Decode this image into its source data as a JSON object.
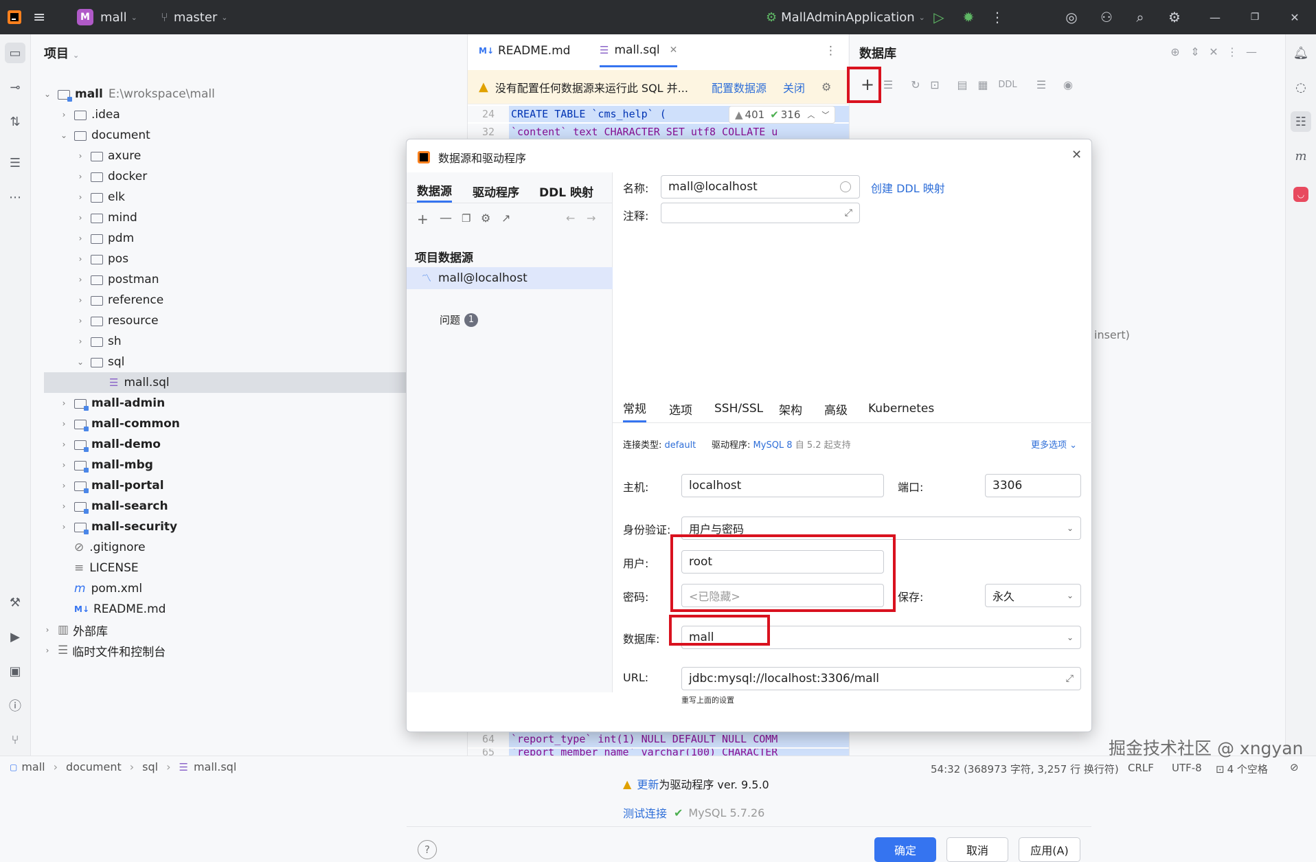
{
  "titlebar": {
    "project_badge": "M",
    "project_name": "mall",
    "branch": "master",
    "run_config": "MallAdminApplication"
  },
  "project_panel": {
    "title": "项目",
    "tree": [
      {
        "label": "mall",
        "extra": "E:\\wrokspace\\mall"
      },
      {
        "label": ".idea"
      },
      {
        "label": "document"
      },
      {
        "label": "axure"
      },
      {
        "label": "docker"
      },
      {
        "label": "elk"
      },
      {
        "label": "mind"
      },
      {
        "label": "pdm"
      },
      {
        "label": "pos"
      },
      {
        "label": "postman"
      },
      {
        "label": "reference"
      },
      {
        "label": "resource"
      },
      {
        "label": "sh"
      },
      {
        "label": "sql"
      },
      {
        "label": "mall.sql"
      },
      {
        "label": "mall-admin"
      },
      {
        "label": "mall-common"
      },
      {
        "label": "mall-demo"
      },
      {
        "label": "mall-mbg"
      },
      {
        "label": "mall-portal"
      },
      {
        "label": "mall-search"
      },
      {
        "label": "mall-security"
      },
      {
        "label": ".gitignore"
      },
      {
        "label": "LICENSE"
      },
      {
        "label": "pom.xml"
      },
      {
        "label": "README.md"
      },
      {
        "label": "外部库"
      },
      {
        "label": "临时文件和控制台"
      }
    ]
  },
  "editor": {
    "tabs": [
      {
        "icon": "M↓",
        "label": "README.md"
      },
      {
        "label": "mall.sql"
      }
    ],
    "warning": "没有配置任何数据源来运行此 SQL 并...",
    "configure_link": "配置数据源",
    "close_link": "关闭",
    "lines": [
      {
        "n": "24",
        "code": "CREATE TABLE `cms_help`  ("
      },
      {
        "n": "32",
        "code": "  `content` text CHARACTER SET utf8 COLLATE u"
      },
      {
        "n": "64",
        "code": "  `report_type` int(1) NULL DEFAULT NULL COMM"
      },
      {
        "n": "65",
        "code": "  `report_member_name` varchar(100) CHARACTER"
      }
    ],
    "warn_count": "401",
    "ok_count": "316",
    "bg_fragment": "insert)"
  },
  "db_panel": {
    "title": "数据库",
    "ddl_label": "DDL"
  },
  "dialog": {
    "title": "数据源和驱动程序",
    "tabs": [
      "数据源",
      "驱动程序",
      "DDL 映射"
    ],
    "section": "项目数据源",
    "datasource": "mall@localhost",
    "problems_label": "问题",
    "problems_count": "1",
    "name_label": "名称:",
    "name_value": "mall@localhost",
    "create_ddl": "创建 DDL 映射",
    "comment_label": "注释:",
    "subtabs": [
      "常规",
      "选项",
      "SSH/SSL",
      "架构",
      "高级",
      "Kubernetes"
    ],
    "conn_type_label": "连接类型:",
    "conn_type_value": "default",
    "driver_label": "驱动程序:",
    "driver_value": "MySQL 8",
    "driver_note": "自 5.2 起支持",
    "more_options": "更多选项",
    "host_label": "主机:",
    "host_value": "localhost",
    "port_label": "端口:",
    "port_value": "3306",
    "auth_label": "身份验证:",
    "auth_value": "用户与密码",
    "user_label": "用户:",
    "user_value": "root",
    "password_label": "密码:",
    "password_placeholder": "<已隐藏>",
    "save_label": "保存:",
    "save_value": "永久",
    "database_label": "数据库:",
    "database_value": "mall",
    "url_label": "URL:",
    "url_value": "jdbc:mysql://localhost:3306/mall",
    "url_hint": "重写上面的设置",
    "update_link": "更新",
    "update_text": "为驱动程序 ver. 9.5.0",
    "test_link": "测试连接",
    "test_result": "MySQL 5.7.26",
    "ok_button": "确定",
    "cancel_button": "取消",
    "apply_button": "应用(A)",
    "help": "?"
  },
  "statusbar": {
    "breadcrumb": [
      "mall",
      "document",
      "sql",
      "mall.sql"
    ],
    "position": "54:32 (368973 字符, 3,257 行 换行符)",
    "line_sep": "CRLF",
    "encoding": "UTF-8",
    "indent": "4 个空格"
  },
  "watermark": "掘金技术社区 @ xngyan",
  "colors": {
    "accent": "#3574f0",
    "highlight": "#d9121f",
    "titlebar": "#2b2d30"
  }
}
